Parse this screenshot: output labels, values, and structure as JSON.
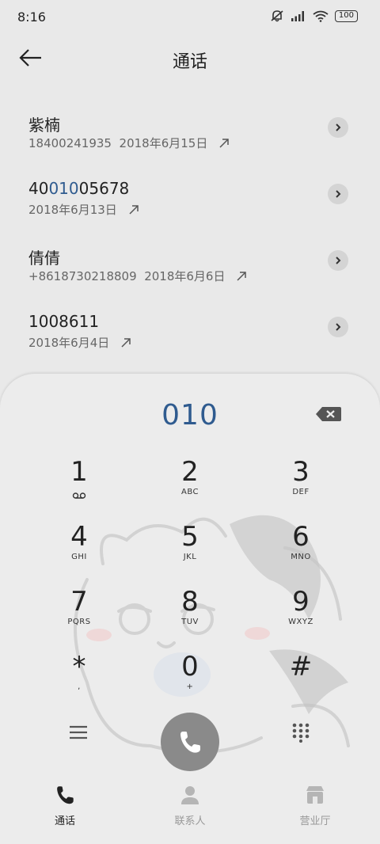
{
  "status_bar": {
    "time": "8:16",
    "battery": "100"
  },
  "header": {
    "title": "通话"
  },
  "calls": [
    {
      "name": "紫楠",
      "number": "18400241935",
      "date": "2018年6月15日"
    },
    {
      "name_pre": "40",
      "name_hl": "010",
      "name_post": "05678",
      "date": "2018年6月13日"
    },
    {
      "name": "倩倩",
      "number": "+8618730218809",
      "date": "2018年6月6日"
    },
    {
      "name": "1008611",
      "date": "2018年6月4日"
    }
  ],
  "dialer": {
    "number": "010",
    "keys": [
      {
        "digit": "1",
        "letters": ""
      },
      {
        "digit": "2",
        "letters": "ABC"
      },
      {
        "digit": "3",
        "letters": "DEF"
      },
      {
        "digit": "4",
        "letters": "GHI"
      },
      {
        "digit": "5",
        "letters": "JKL"
      },
      {
        "digit": "6",
        "letters": "MNO"
      },
      {
        "digit": "7",
        "letters": "PQRS"
      },
      {
        "digit": "8",
        "letters": "TUV"
      },
      {
        "digit": "9",
        "letters": "WXYZ"
      },
      {
        "digit": "*",
        "letters": ","
      },
      {
        "digit": "0",
        "letters": "+"
      },
      {
        "digit": "#",
        "letters": ""
      }
    ]
  },
  "nav": {
    "calls": "通话",
    "contacts": "联系人",
    "store": "营业厅"
  },
  "colors": {
    "accent": "#2f5b8f",
    "call_button": "#8a8a8a"
  }
}
